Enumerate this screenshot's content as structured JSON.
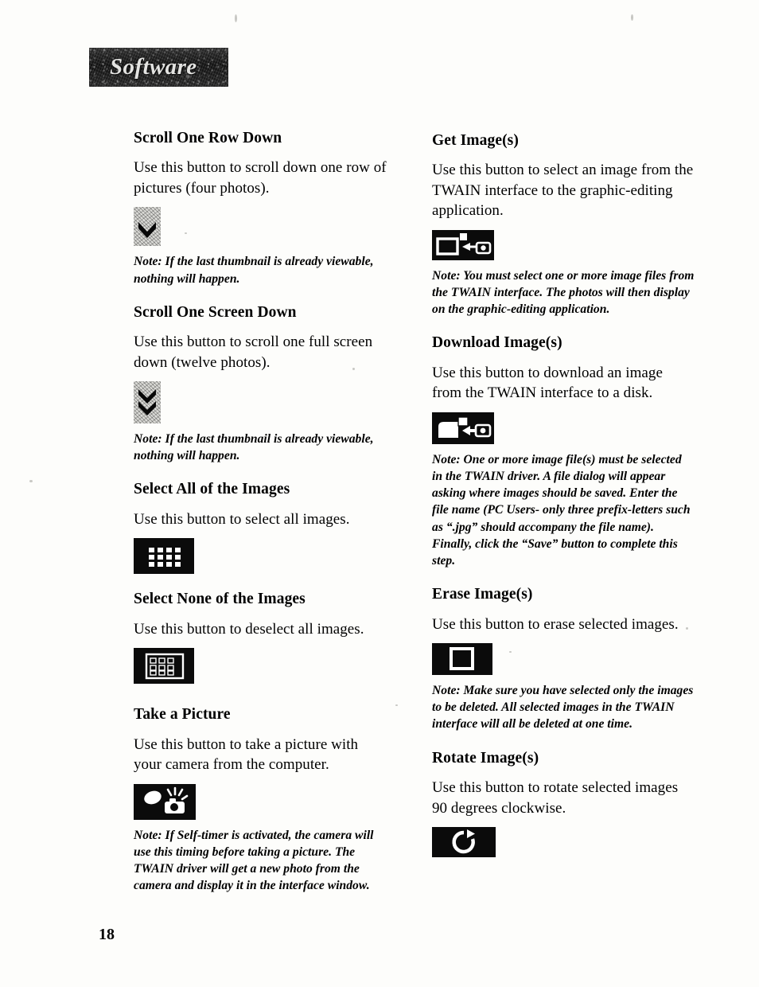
{
  "page": {
    "banner_title": "Software",
    "page_number": "18"
  },
  "left_column": [
    {
      "title": "Scroll One Row Down",
      "body": "Use this button to scroll down one row of pictures (four photos).",
      "icon": "chevron-down-icon",
      "note": "Note: If the last thumbnail is already viewable, nothing will happen."
    },
    {
      "title": "Scroll One Screen Down",
      "body": "Use this button to scroll one full screen down (twelve photos).",
      "icon": "double-chevron-down-icon",
      "note": "Note: If the last thumbnail is already viewable, nothing will happen."
    },
    {
      "title": "Select All of the Images",
      "body": "Use this button to select all images.",
      "icon": "select-all-grid-icon",
      "note": ""
    },
    {
      "title": "Select None of the Images",
      "body": "Use this button to deselect all images.",
      "icon": "select-none-grid-icon",
      "note": ""
    },
    {
      "title": "Take a Picture",
      "body": "Use this button to take a picture with your camera from the computer.",
      "icon": "camera-flash-icon",
      "note": "Note: If Self-timer is activated, the camera will use this timing before taking a picture. The TWAIN driver will get a new photo from the camera and display it in the interface window."
    }
  ],
  "right_column": [
    {
      "title": "Get Image(s)",
      "body": "Use this button to select an image from the TWAIN interface to the graphic-editing application.",
      "icon": "get-image-icon",
      "note": "Note: You must select one or more image files from the TWAIN interface. The photos will then display on the graphic-editing application."
    },
    {
      "title": "Download Image(s)",
      "body": "Use this button to download an image from the TWAIN interface to a disk.",
      "icon": "download-image-icon",
      "note": "Note: One or more image file(s) must be selected in the TWAIN driver. A file dialog will appear asking where images should be saved. Enter the file name (PC Users- only three prefix-letters such as “.jpg” should accompany the file name). Finally, click the “Save” button to complete this step."
    },
    {
      "title": "Erase Image(s)",
      "body": "Use this button to erase selected images.",
      "icon": "erase-image-icon",
      "note": "Note: Make sure you have selected only the images to be deleted. All selected images in the TWAIN interface will all be deleted at one time."
    },
    {
      "title": "Rotate Image(s)",
      "body": "Use this button to rotate selected images 90 degrees clockwise.",
      "icon": "rotate-image-icon",
      "note": ""
    }
  ]
}
